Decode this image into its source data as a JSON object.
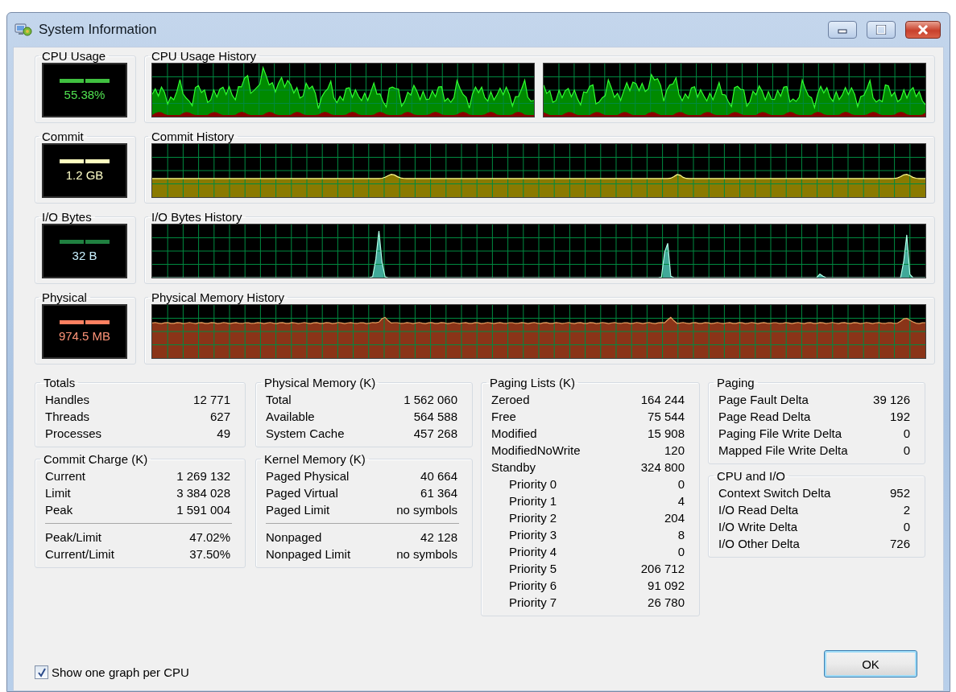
{
  "window": {
    "title": "System Information",
    "controls": [
      {
        "kind": "minimize"
      },
      {
        "kind": "maximize"
      },
      {
        "kind": "close"
      }
    ]
  },
  "graph_rows": [
    {
      "kind": "cpu",
      "meter_label": "CPU Usage",
      "meter_value": "55.38%",
      "history_label": "CPU Usage History"
    },
    {
      "kind": "commit",
      "meter_label": "Commit",
      "meter_value": "1.2 GB",
      "history_label": "Commit History"
    },
    {
      "kind": "io",
      "meter_label": "I/O Bytes",
      "meter_value": "32 B",
      "history_label": "I/O Bytes History"
    },
    {
      "kind": "physical",
      "meter_label": "Physical",
      "meter_value": "974.5 MB",
      "history_label": "Physical Memory History"
    }
  ],
  "columns": [
    [
      {
        "title": "Totals",
        "sections": [
          [
            {
              "label": "Handles",
              "value": "12 771",
              "kind": "plain"
            },
            {
              "label": "Threads",
              "value": "627",
              "kind": "plain"
            },
            {
              "label": "Processes",
              "value": "49",
              "kind": "plain"
            }
          ]
        ]
      },
      {
        "title": "Commit Charge (K)",
        "sections": [
          [
            {
              "label": "Current",
              "value": "1 269 132",
              "kind": "plain"
            },
            {
              "label": "Limit",
              "value": "3 384 028",
              "kind": "plain"
            },
            {
              "label": "Peak",
              "value": "1 591 004",
              "kind": "plain"
            }
          ],
          [
            {
              "label": "Peak/Limit",
              "value": "47.02%",
              "kind": "plain"
            },
            {
              "label": "Current/Limit",
              "value": "37.50%",
              "kind": "plain"
            }
          ]
        ]
      }
    ],
    [
      {
        "title": "Physical Memory (K)",
        "sections": [
          [
            {
              "label": "Total",
              "value": "1 562 060",
              "kind": "plain"
            },
            {
              "label": "Available",
              "value": "564 588",
              "kind": "plain"
            },
            {
              "label": "System Cache",
              "value": "457 268",
              "kind": "plain"
            }
          ]
        ]
      },
      {
        "title": "Kernel Memory (K)",
        "sections": [
          [
            {
              "label": "Paged Physical",
              "value": "40 664",
              "kind": "plain"
            },
            {
              "label": "Paged Virtual",
              "value": "61 364",
              "kind": "plain"
            },
            {
              "label": "Paged Limit",
              "value": "no symbols",
              "kind": "plain"
            }
          ],
          [
            {
              "label": "Nonpaged",
              "value": "42 128",
              "kind": "plain"
            },
            {
              "label": "Nonpaged Limit",
              "value": "no symbols",
              "kind": "plain"
            }
          ]
        ]
      }
    ],
    [
      {
        "title": "Paging Lists (K)",
        "sections": [
          [
            {
              "label": "Zeroed",
              "value": "164 244",
              "kind": "plain"
            },
            {
              "label": "Free",
              "value": "75 544",
              "kind": "plain"
            },
            {
              "label": "Modified",
              "value": "15 908",
              "kind": "plain"
            },
            {
              "label": "ModifiedNoWrite",
              "value": "120",
              "kind": "plain"
            },
            {
              "label": "Standby",
              "value": "324 800",
              "kind": "plain"
            },
            {
              "label": "Priority 0",
              "value": "0",
              "kind": "indented"
            },
            {
              "label": "Priority 1",
              "value": "4",
              "kind": "indented"
            },
            {
              "label": "Priority 2",
              "value": "204",
              "kind": "indented"
            },
            {
              "label": "Priority 3",
              "value": "8",
              "kind": "indented"
            },
            {
              "label": "Priority 4",
              "value": "0",
              "kind": "indented"
            },
            {
              "label": "Priority 5",
              "value": "206 712",
              "kind": "indented"
            },
            {
              "label": "Priority 6",
              "value": "91 092",
              "kind": "indented"
            },
            {
              "label": "Priority 7",
              "value": "26 780",
              "kind": "indented"
            }
          ]
        ]
      }
    ],
    [
      {
        "title": "Paging",
        "sections": [
          [
            {
              "label": "Page Fault Delta",
              "value": "39 126",
              "kind": "plain"
            },
            {
              "label": "Page Read Delta",
              "value": "192",
              "kind": "plain"
            },
            {
              "label": "Paging File Write Delta",
              "value": "0",
              "kind": "plain"
            },
            {
              "label": "Mapped File Write Delta",
              "value": "0",
              "kind": "plain"
            }
          ]
        ]
      },
      {
        "title": "CPU and I/O",
        "sections": [
          [
            {
              "label": "Context Switch Delta",
              "value": "952",
              "kind": "plain"
            },
            {
              "label": "I/O Read Delta",
              "value": "2",
              "kind": "plain"
            },
            {
              "label": "I/O Write Delta",
              "value": "0",
              "kind": "plain"
            },
            {
              "label": "I/O Other Delta",
              "value": "726",
              "kind": "plain"
            }
          ]
        ]
      }
    ]
  ],
  "checkbox": {
    "label": "Show one graph per CPU",
    "checked": true
  },
  "ok_button": "OK"
}
